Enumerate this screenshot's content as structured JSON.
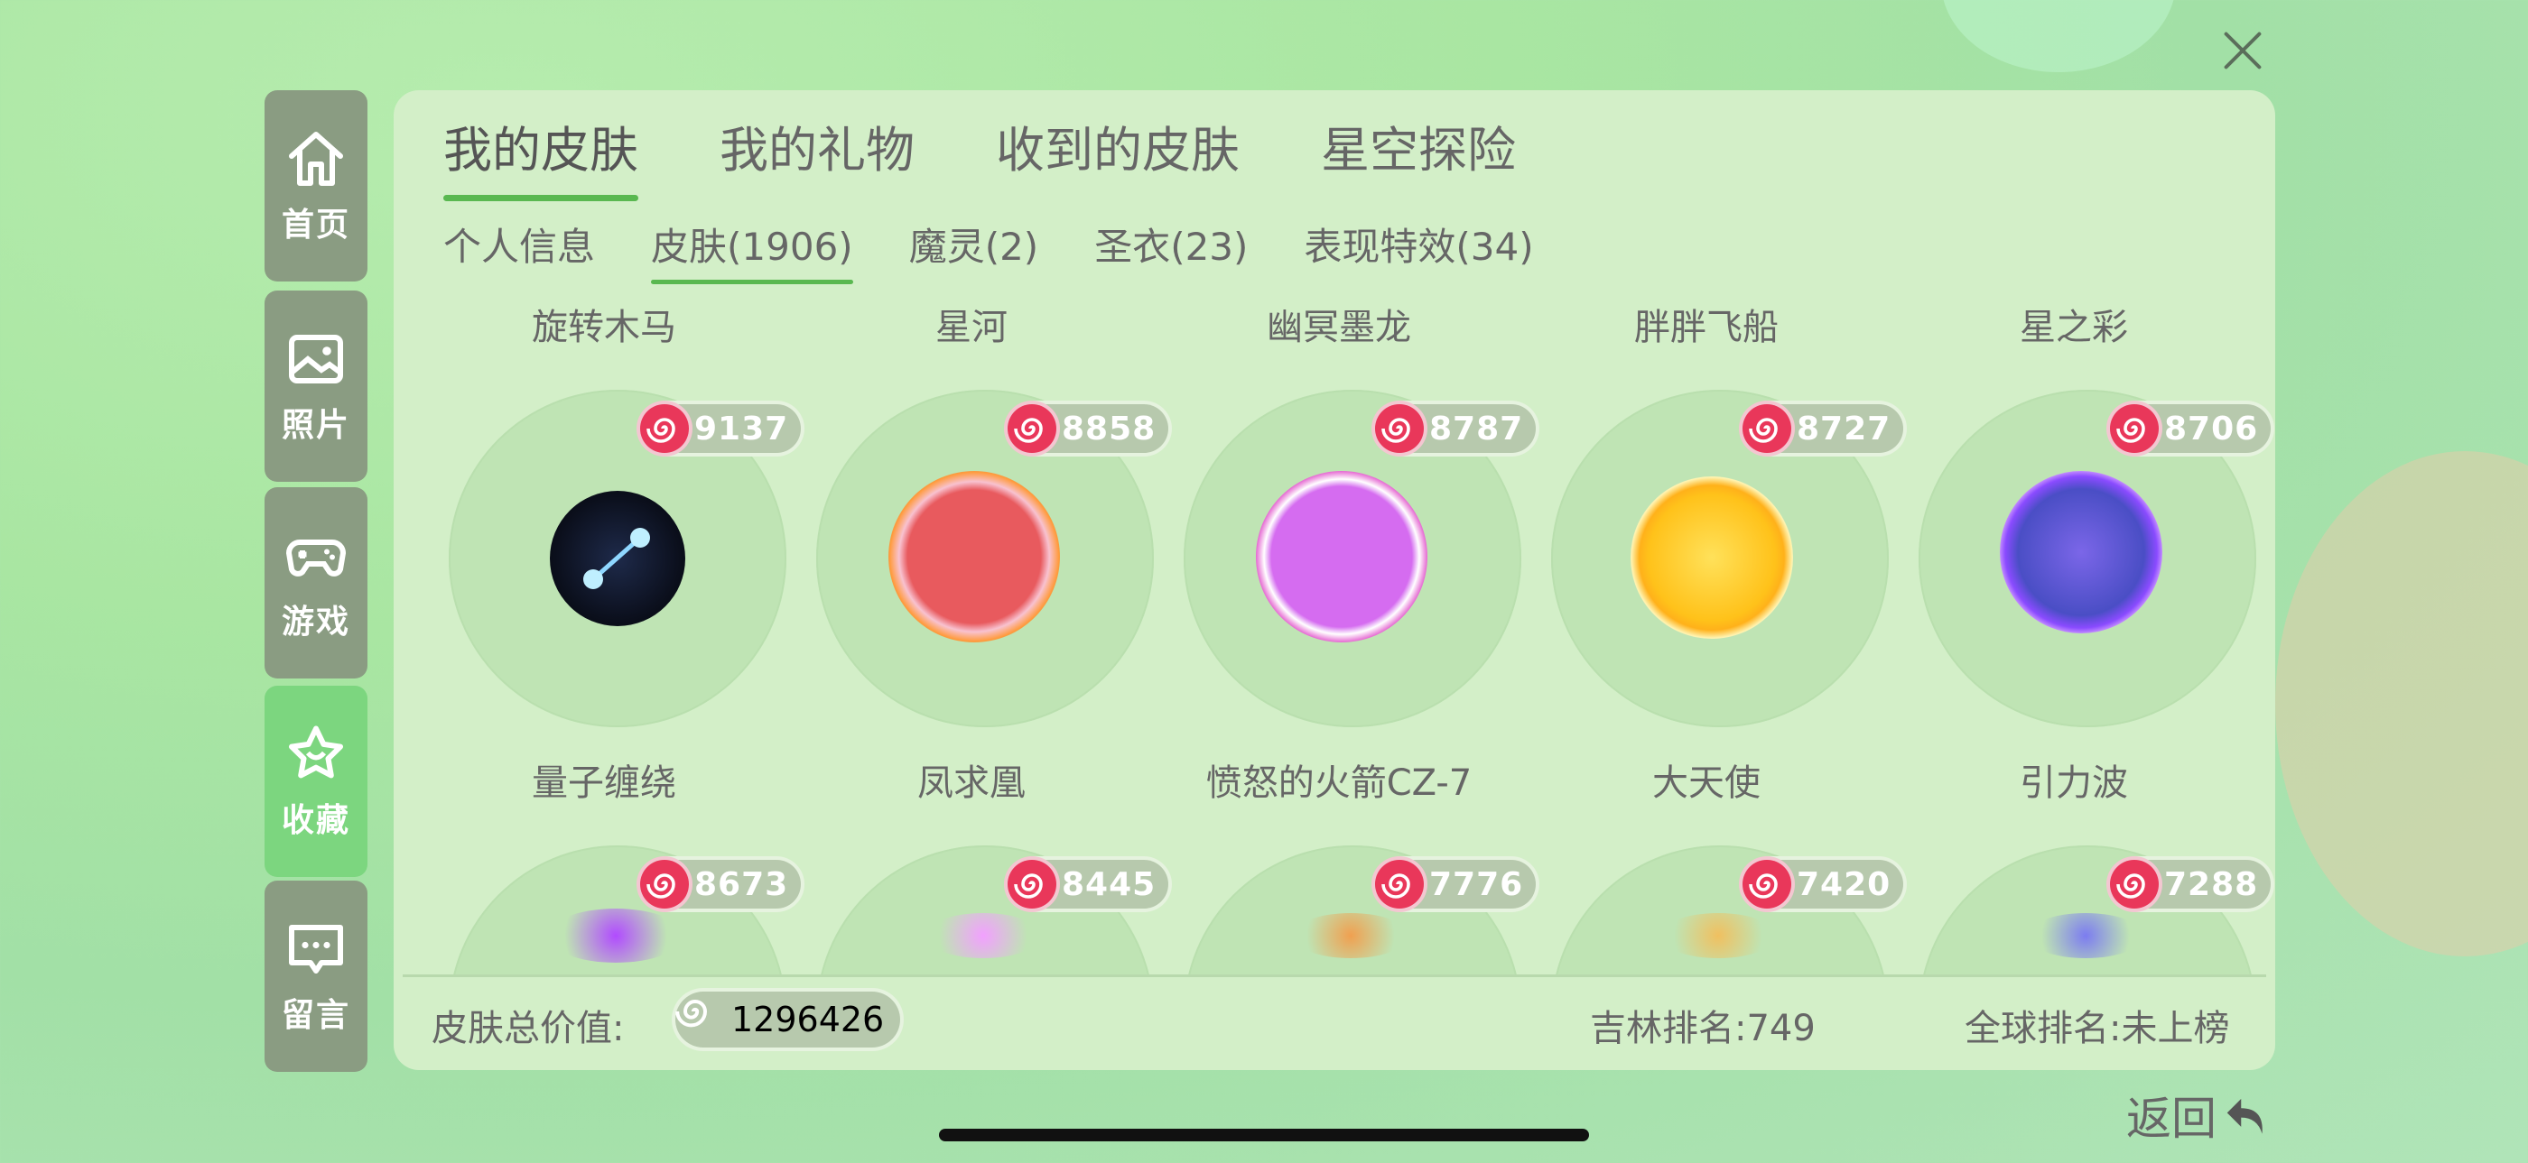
{
  "sidebar": {
    "items": [
      {
        "label": "首页",
        "icon": "home-icon",
        "active": false
      },
      {
        "label": "照片",
        "icon": "photo-icon",
        "active": false
      },
      {
        "label": "游戏",
        "icon": "gamepad-icon",
        "active": false
      },
      {
        "label": "收藏",
        "icon": "star-icon",
        "active": true
      },
      {
        "label": "留言",
        "icon": "message-icon",
        "active": false
      }
    ]
  },
  "tabs": [
    "我的皮肤",
    "我的礼物",
    "收到的皮肤",
    "星空探险"
  ],
  "subtabs": [
    "个人信息",
    "皮肤(1906)",
    "魔灵(2)",
    "圣衣(23)",
    "表现特效(34)"
  ],
  "skins_row1": [
    {
      "name": "旋转木马",
      "value": "9137",
      "caption": "量子缠绕"
    },
    {
      "name": "星河",
      "value": "8858",
      "caption": "凤求凰"
    },
    {
      "name": "幽冥墨龙",
      "value": "8787",
      "caption": "愤怒的火箭CZ-7"
    },
    {
      "name": "胖胖飞船",
      "value": "8727",
      "caption": "大天使"
    },
    {
      "name": "星之彩",
      "value": "8706",
      "caption": "引力波"
    }
  ],
  "skins_row2": [
    {
      "value": "8673"
    },
    {
      "value": "8445"
    },
    {
      "value": "7776"
    },
    {
      "value": "7420"
    },
    {
      "value": "7288"
    }
  ],
  "footer": {
    "total_label": "皮肤总价值:",
    "total_value": "1296426",
    "local_rank": "吉林排名:749",
    "global_rank": "全球排名:未上榜"
  },
  "back_label": "返回",
  "colors": {
    "accent_green": "#59b850",
    "sidebar_active": "#7cd67f",
    "sidebar_inactive": "#8a9c82",
    "candy_red": "#e9375a"
  }
}
